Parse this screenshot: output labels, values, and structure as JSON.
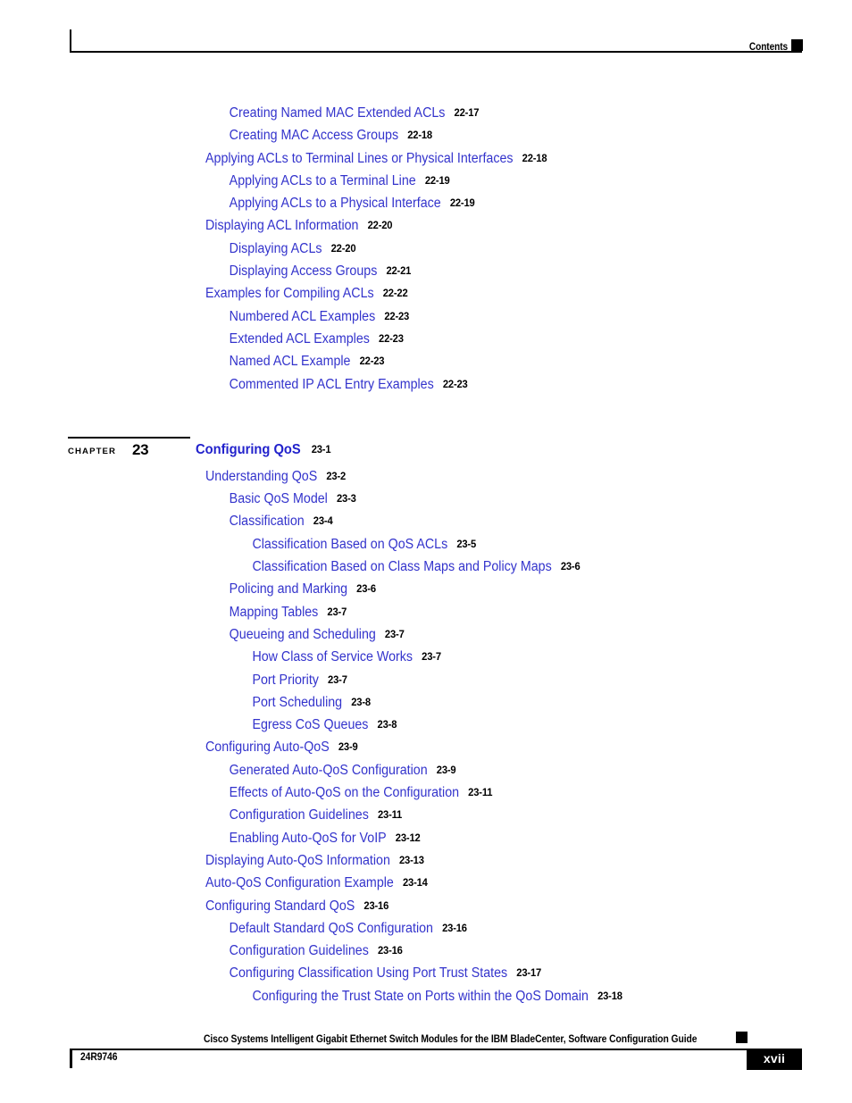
{
  "header": {
    "title": "Contents",
    "square_icon": "black-square-marker"
  },
  "footer": {
    "title": "Cisco Systems Intelligent Gigabit Ethernet Switch Modules for the IBM BladeCenter, Software Configuration Guide",
    "document_number": "24R9746",
    "page_number": "xvii",
    "square_icon": "black-square-marker"
  },
  "chapter": {
    "word": "CHAPTER",
    "number": "23",
    "title": "Configuring QoS",
    "page": "23-1"
  },
  "toc": {
    "group_a": [
      {
        "level": 2,
        "label": "Creating Named MAC Extended ACLs",
        "page": "22-17"
      },
      {
        "level": 2,
        "label": "Creating MAC Access Groups",
        "page": "22-18"
      },
      {
        "level": 1,
        "label": "Applying ACLs to Terminal Lines or Physical Interfaces",
        "page": "22-18"
      },
      {
        "level": 2,
        "label": "Applying ACLs to a Terminal Line",
        "page": "22-19"
      },
      {
        "level": 2,
        "label": "Applying ACLs to a Physical Interface",
        "page": "22-19"
      },
      {
        "level": 1,
        "label": "Displaying ACL Information",
        "page": "22-20"
      },
      {
        "level": 2,
        "label": "Displaying ACLs",
        "page": "22-20"
      },
      {
        "level": 2,
        "label": "Displaying Access Groups",
        "page": "22-21"
      },
      {
        "level": 1,
        "label": "Examples for Compiling ACLs",
        "page": "22-22"
      },
      {
        "level": 2,
        "label": "Numbered ACL Examples",
        "page": "22-23"
      },
      {
        "level": 2,
        "label": "Extended ACL Examples",
        "page": "22-23"
      },
      {
        "level": 2,
        "label": "Named ACL Example",
        "page": "22-23"
      },
      {
        "level": 2,
        "label": "Commented IP ACL Entry Examples",
        "page": "22-23"
      }
    ],
    "group_b": [
      {
        "level": 1,
        "label": "Understanding QoS",
        "page": "23-2"
      },
      {
        "level": 2,
        "label": "Basic QoS Model",
        "page": "23-3"
      },
      {
        "level": 2,
        "label": "Classification",
        "page": "23-4"
      },
      {
        "level": 3,
        "label": "Classification Based on QoS ACLs",
        "page": "23-5"
      },
      {
        "level": 3,
        "label": "Classification Based on Class Maps and Policy Maps",
        "page": "23-6"
      },
      {
        "level": 2,
        "label": "Policing and Marking",
        "page": "23-6"
      },
      {
        "level": 2,
        "label": "Mapping Tables",
        "page": "23-7"
      },
      {
        "level": 2,
        "label": "Queueing and Scheduling",
        "page": "23-7"
      },
      {
        "level": 3,
        "label": "How Class of Service Works",
        "page": "23-7"
      },
      {
        "level": 3,
        "label": "Port Priority",
        "page": "23-7"
      },
      {
        "level": 3,
        "label": "Port Scheduling",
        "page": "23-8"
      },
      {
        "level": 3,
        "label": "Egress CoS Queues",
        "page": "23-8"
      },
      {
        "level": 1,
        "label": "Configuring Auto-QoS",
        "page": "23-9"
      },
      {
        "level": 2,
        "label": "Generated Auto-QoS Configuration",
        "page": "23-9"
      },
      {
        "level": 2,
        "label": "Effects of Auto-QoS on the Configuration",
        "page": "23-11"
      },
      {
        "level": 2,
        "label": "Configuration Guidelines",
        "page": "23-11"
      },
      {
        "level": 2,
        "label": "Enabling Auto-QoS for VoIP",
        "page": "23-12"
      },
      {
        "level": 1,
        "label": "Displaying Auto-QoS Information",
        "page": "23-13"
      },
      {
        "level": 1,
        "label": "Auto-QoS Configuration Example",
        "page": "23-14"
      },
      {
        "level": 1,
        "label": "Configuring Standard QoS",
        "page": "23-16"
      },
      {
        "level": 2,
        "label": "Default Standard QoS Configuration",
        "page": "23-16"
      },
      {
        "level": 2,
        "label": "Configuration Guidelines",
        "page": "23-16"
      },
      {
        "level": 2,
        "label": "Configuring Classification Using Port Trust States",
        "page": "23-17"
      },
      {
        "level": 3,
        "label": "Configuring the Trust State on Ports within the QoS Domain",
        "page": "23-18"
      }
    ]
  }
}
